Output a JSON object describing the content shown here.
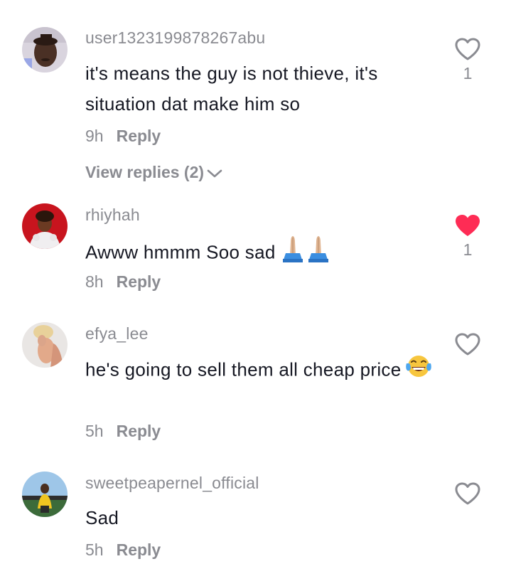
{
  "comments": [
    {
      "username": "user1323199878267abu",
      "text": "it's means the guy is not thieve, it's situation dat make him so",
      "time": "9h",
      "reply_label": "Reply",
      "view_replies": "View replies (2)",
      "likes": "1",
      "liked": false
    },
    {
      "username": "rhiyhah",
      "text": "Awww hmmm Soo sad",
      "emoji": "folded-hands x2",
      "time": "8h",
      "reply_label": "Reply",
      "likes": "1",
      "liked": true
    },
    {
      "username": "efya_lee",
      "text": "he's going to sell them all cheap price",
      "emoji": "face-with-tears-of-joy",
      "time": "5h",
      "reply_label": "Reply",
      "likes": "",
      "liked": false
    },
    {
      "username": "sweetpeapernel_official",
      "text": "Sad",
      "time": "5h",
      "reply_label": "Reply",
      "likes": "",
      "liked": false
    }
  ],
  "colors": {
    "username": "#8a8b91",
    "text": "#161823",
    "liked_heart": "#fe2c55",
    "heart_outline": "#8a8b91"
  },
  "icons": {
    "like": "heart-icon",
    "expand": "chevron-down-icon"
  }
}
